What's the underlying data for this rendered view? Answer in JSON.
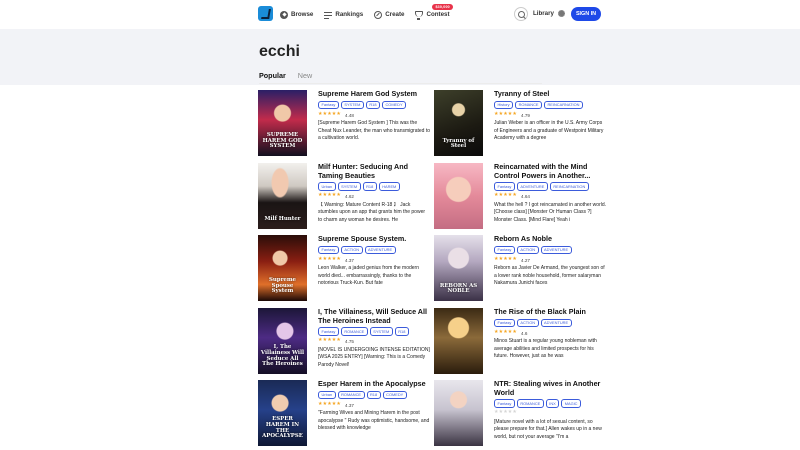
{
  "nav": {
    "items": [
      {
        "label": "Browse",
        "icon": "compass-icon"
      },
      {
        "label": "Rankings",
        "icon": "rankings-icon"
      },
      {
        "label": "Create",
        "icon": "pen-icon"
      },
      {
        "label": "Contest",
        "icon": "trophy-icon",
        "badge": "$30,000"
      }
    ],
    "library_label": "Library",
    "signin_label": "SIGN IN"
  },
  "page": {
    "title": "ecchi",
    "tabs": [
      "Popular",
      "New"
    ],
    "active_tab": "Popular"
  },
  "colors": {
    "accent": "#1e49e8",
    "tag": "#3b5bdb",
    "star": "#f5a623",
    "hero_bg": "#f2f3f7"
  },
  "books": [
    {
      "title": "Supreme Harem God System",
      "tags": [
        "Fantasy",
        "SYSTEM",
        "R18",
        "COMEDY"
      ],
      "stars": 5,
      "rating": "4.48",
      "description": "[Supreme Harem God System ] This was the Cheat Nux Leander, the man who transmigrated to a cultivation world.",
      "cover_text": "SUPREME HAREM GOD SYSTEM"
    },
    {
      "title": "Tyranny of Steel",
      "tags": [
        "History",
        "ROMANCE",
        "REINCARNATION"
      ],
      "stars": 5,
      "rating": "4.79",
      "description": "Julian Weber is an officer in the U.S. Army Corps of Engineers and a graduate of Westpoint Military Academy with a degree",
      "cover_text": "Tyranny of Steel"
    },
    {
      "title": "Milf Hunter: Seducing And Taming Beauties",
      "tags": [
        "Urban",
        "SYSTEM",
        "R18",
        "HAREM"
      ],
      "stars": 5,
      "rating": "4.62",
      "description": "【 Warning: Mature Content R-18 】 Jack stumbles upon an app that grants him the power to charm any woman he desires. He",
      "cover_text": "Milf Hunter"
    },
    {
      "title": "Reincarnated with the Mind Control Powers in Another...",
      "tags": [
        "Fantasy",
        "ADVENTURE",
        "REINCARNATION"
      ],
      "stars": 5,
      "rating": "4.64",
      "description": "What the hell ? I got reincarnated in another world. [Choose class] [Monster Or Human Class ?] Monster Class. [Mind Flare] Yeah i",
      "cover_text": ""
    },
    {
      "title": "Supreme Spouse System.",
      "tags": [
        "Fantasy",
        "ACTION",
        "ADVENTURE"
      ],
      "stars": 5,
      "rating": "4.37",
      "description": "Leon Walker, a jaded genius from the modern world died... embarrassingly, thanks to the notorious Truck-Kun. But fate",
      "cover_text": "Supreme Spouse System"
    },
    {
      "title": "Reborn As Noble",
      "tags": [
        "Fantasy",
        "ACTION",
        "ADVENTURE"
      ],
      "stars": 5,
      "rating": "4.27",
      "description": "Reborn as Javier De Armand, the youngest son of a lower rank noble household, former salaryman Nakamura Junichi faces",
      "cover_text": "REBORN AS NOBLE"
    },
    {
      "title": "I, The Villainess, Will Seduce All The Heroines Instead",
      "tags": [
        "Fantasy",
        "ROMANCE",
        "SYSTEM",
        "R18"
      ],
      "stars": 5,
      "rating": "4.75",
      "description": "[NOVEL IS UNDERGOING INTENSE EDITATION] [WSA 2025 ENTRY] [Warning: This is a Comedy Parody Novel!",
      "cover_text": "I, The Villainess Will Seduce All The Heroines"
    },
    {
      "title": "The Rise of the Black Plain",
      "tags": [
        "Fantasy",
        "ACTION",
        "ADVENTURE"
      ],
      "stars": 5,
      "rating": "4.6",
      "description": "Minos Stuart is a regular young nobleman with average abilities and limited prospects for his future. However, just as he was",
      "cover_text": ""
    },
    {
      "title": "Esper Harem in the Apocalypse",
      "tags": [
        "Urban",
        "ROMANCE",
        "R18",
        "COMEDY"
      ],
      "stars": 5,
      "rating": "4.37",
      "description": "\"Farming Wives and Mining Harem in the post apocalypse \" Rudy was optimistic, handsome, and blessed with knowledge",
      "cover_text": "ESPER HAREM IN THE APOCALYPSE"
    },
    {
      "title": "NTR: Stealing wives in Another World",
      "tags": [
        "Fantasy",
        "ROMANCE",
        "INX",
        "MAGIC"
      ],
      "stars": 0,
      "rating": "",
      "description": "[Mature novel with a lot of sexual content, so please prepare for that.] Allen wakes up in a new world, but not your average \"I'm a",
      "cover_text": ""
    }
  ]
}
